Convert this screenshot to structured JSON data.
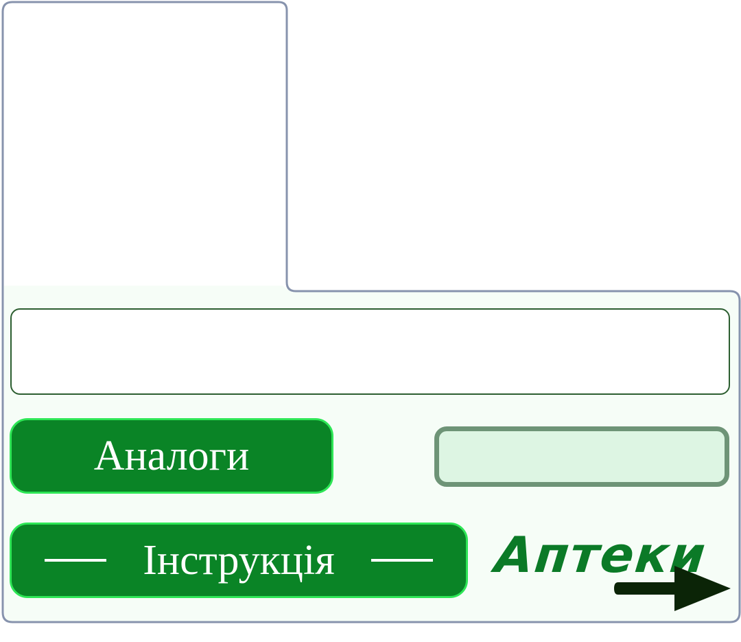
{
  "search": {
    "value": "",
    "placeholder": ""
  },
  "buttons": {
    "analogy_label": "Аналоги",
    "instruction_label": "Інструкція"
  },
  "pharmacies": {
    "label": "Аптеки",
    "icon": "arrow-right-icon"
  },
  "colors": {
    "button_fill": "#0a8426",
    "button_border": "#2ee656",
    "panel_background": "#f6fdf7",
    "outline": "#8793ad",
    "light_box": "#ddf5e3",
    "light_box_border": "#6e9477",
    "label_green": "#0b7a27",
    "arrow": "#0b2407"
  }
}
